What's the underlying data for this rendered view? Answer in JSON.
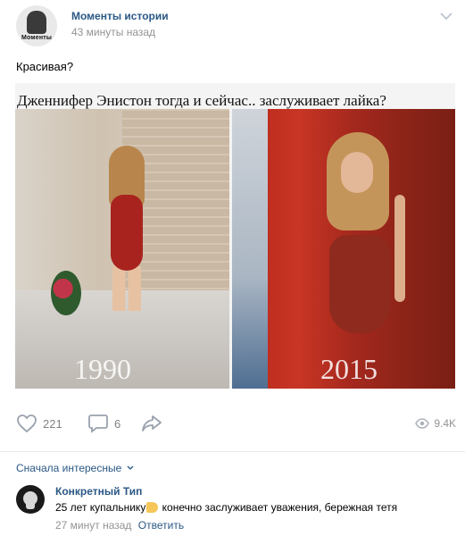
{
  "post": {
    "author": "Моменты истории",
    "avatar_text": "Моменты",
    "time": "43 минуты назад",
    "text": "Красивая?"
  },
  "photo": {
    "caption": "Дженнифер Энистон тогда и сейчас.. заслуживает лайка?",
    "year_left": "1990",
    "year_right": "2015"
  },
  "actions": {
    "likes": "221",
    "comments": "6",
    "views": "9.4K"
  },
  "comments": {
    "sort_label": "Сначала интересные",
    "items": [
      {
        "author": "Конкретный Тип",
        "text_before": "25 лет купальнику",
        "text_after": " конечно заслуживает уважения, бережная тетя",
        "time": "27 минут назад",
        "reply_label": "Ответить"
      }
    ]
  },
  "icons": {
    "like": "heart-icon",
    "comment": "comment-icon",
    "share": "share-icon",
    "views": "eye-icon",
    "menu": "chevron-down-icon",
    "emoji": "thumbs-up-emoji"
  },
  "colors": {
    "link": "#2a5885",
    "muted": "#939393",
    "icon": "#828282"
  }
}
